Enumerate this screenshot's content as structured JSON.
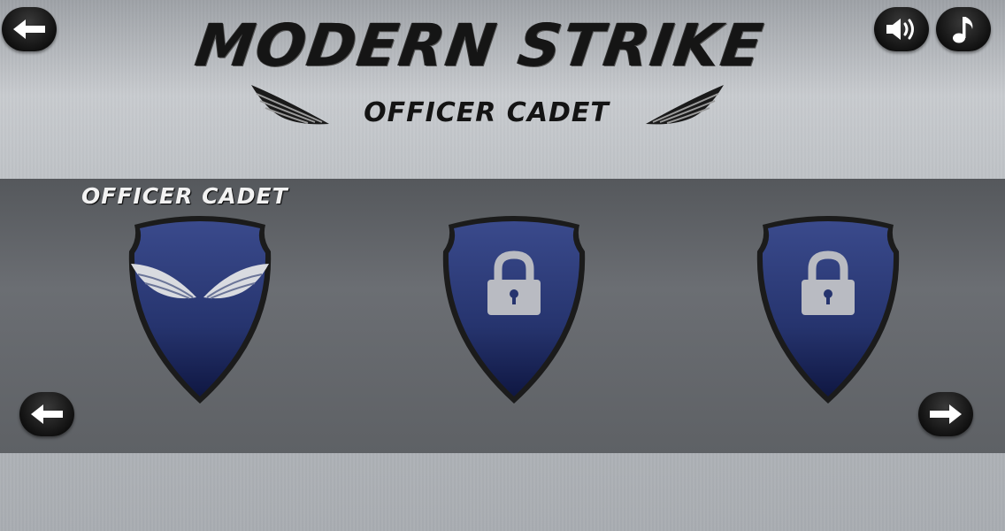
{
  "header": {
    "title": "MODERN STRIKE",
    "subtitle": "OFFICER CADET"
  },
  "buttons": {
    "back_icon": "arrow-left-icon",
    "sound_icon": "speaker-icon",
    "music_icon": "music-note-icon",
    "prev_icon": "arrow-left-icon",
    "next_icon": "arrow-right-icon"
  },
  "ranks": {
    "selected_label": "OFFICER CADET",
    "items": [
      {
        "state": "unlocked",
        "emblem": "wings-icon"
      },
      {
        "state": "locked",
        "emblem": "lock-icon"
      },
      {
        "state": "locked",
        "emblem": "lock-icon"
      }
    ]
  },
  "colors": {
    "shield_blue": "#2c3a78",
    "shield_dark": "#101840",
    "button_black": "#111111"
  }
}
